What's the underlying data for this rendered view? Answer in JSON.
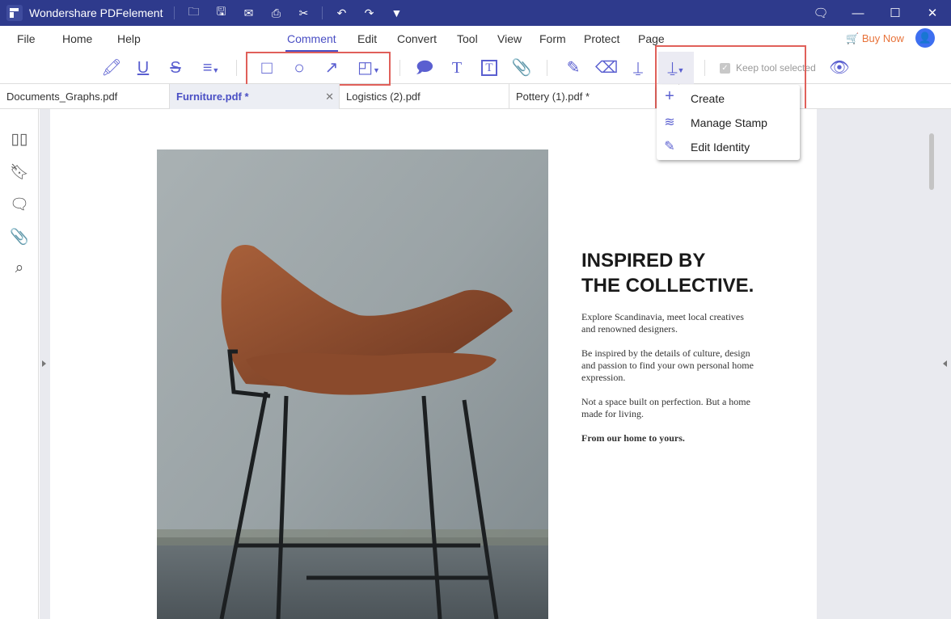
{
  "app": {
    "title": "Wondershare PDFelement"
  },
  "quick_icons": [
    "open-folder-icon",
    "save-icon",
    "mail-icon",
    "print-icon",
    "scissors-icon",
    "undo-icon",
    "redo-icon",
    "customize-icon"
  ],
  "menu": {
    "items": [
      "File",
      "Home",
      "Help",
      "Comment",
      "Edit",
      "Convert",
      "Tool",
      "View",
      "Form",
      "Protect",
      "Page"
    ],
    "active": "Comment",
    "buy_now": "Buy Now"
  },
  "toolbar": {
    "keep_tool_selected": "Keep tool selected",
    "keep_checked": true
  },
  "tabs": [
    {
      "label": "Documents_Graphs.pdf"
    },
    {
      "label": "Furniture.pdf *",
      "active": true
    },
    {
      "label": "Logistics (2).pdf"
    },
    {
      "label": "Pottery (1).pdf *"
    }
  ],
  "stamp_menu": {
    "items": [
      "Create",
      "Manage Stamp",
      "Edit Identity"
    ]
  },
  "document": {
    "heading1": "INSPIRED BY",
    "heading2": "THE COLLECTIVE.",
    "p1": "Explore Scandinavia, meet local creatives and renowned designers.",
    "p2": "Be inspired by the details of culture, design and passion to find your own personal home expression.",
    "p3": "Not a space built on perfection. But a home made for living.",
    "p4": "From our home to yours."
  },
  "colors": {
    "titlebar": "#2e3a8c",
    "accent": "#4a4fc4",
    "highlight_box": "#e0605a",
    "buy_now": "#e8733a"
  }
}
